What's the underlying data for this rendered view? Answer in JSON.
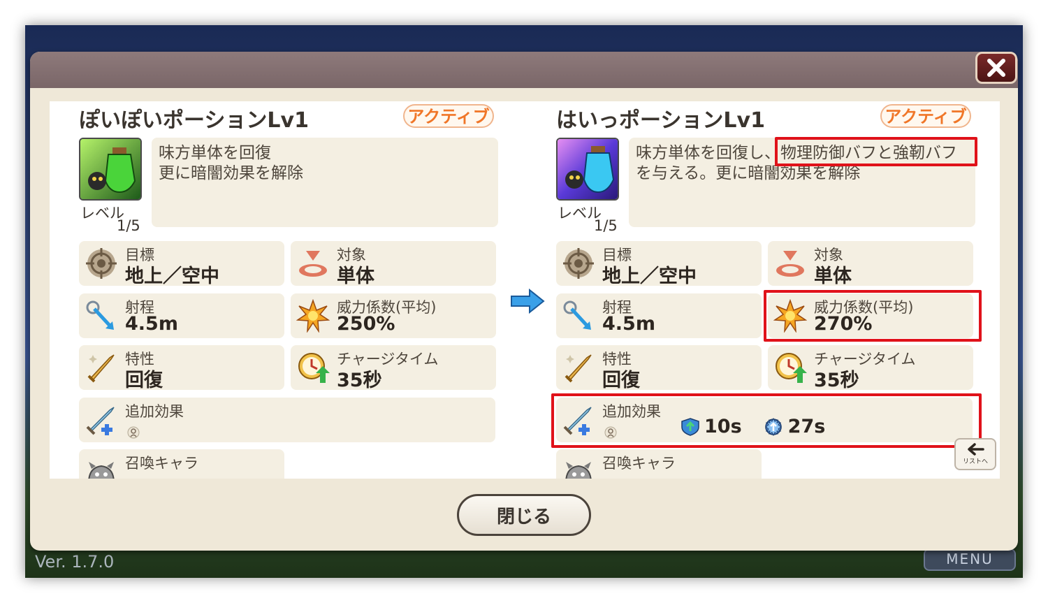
{
  "app": {
    "version": "Ver. 1.7.0",
    "menu_label": "MENU"
  },
  "dialog": {
    "close_button_label": "閉じる",
    "list_button_label": "リストへ"
  },
  "left_skill": {
    "name": "ぽいぽいポーションLv1",
    "type_badge": "アクティブ",
    "level_label": "レベル",
    "level_value": "1/5",
    "description_lines": [
      "味方単体を回復",
      "更に暗闇効果を解除"
    ],
    "stats": {
      "target_type": {
        "label": "目標",
        "value": "地上／空中"
      },
      "target": {
        "label": "対象",
        "value": "単体"
      },
      "range": {
        "label": "射程",
        "value": "4.5m"
      },
      "power": {
        "label": "威力係数(平均)",
        "value": "250%"
      },
      "trait": {
        "label": "特性",
        "value": "回復"
      },
      "charge": {
        "label": "チャージタイム",
        "value": "35秒"
      },
      "extra_effect": {
        "label": "追加効果"
      },
      "summon": {
        "label": "召喚キャラ"
      }
    }
  },
  "right_skill": {
    "name": "はいっポーションLv1",
    "type_badge": "アクティブ",
    "level_label": "レベル",
    "level_value": "1/5",
    "description_line1_plain": "味方単体を回復し、",
    "description_line1_highlight": "物理防御バフと強靭バフ",
    "description_line2": "を与える。更に暗闇効果を解除",
    "stats": {
      "target_type": {
        "label": "目標",
        "value": "地上／空中"
      },
      "target": {
        "label": "対象",
        "value": "単体"
      },
      "range": {
        "label": "射程",
        "value": "4.5m"
      },
      "power": {
        "label": "威力係数(平均)",
        "value": "270%"
      },
      "trait": {
        "label": "特性",
        "value": "回復"
      },
      "charge": {
        "label": "チャージタイム",
        "value": "35秒"
      },
      "extra_effect": {
        "label": "追加効果",
        "buffs": [
          {
            "icon": "physical-defense-buff-icon",
            "duration": "10s"
          },
          {
            "icon": "toughness-buff-icon",
            "duration": "27s"
          }
        ]
      },
      "summon": {
        "label": "召喚キャラ"
      }
    }
  },
  "colors": {
    "badge_text": "#f07628",
    "highlight": "#e0121a",
    "arrow": "#3aa0e8"
  }
}
